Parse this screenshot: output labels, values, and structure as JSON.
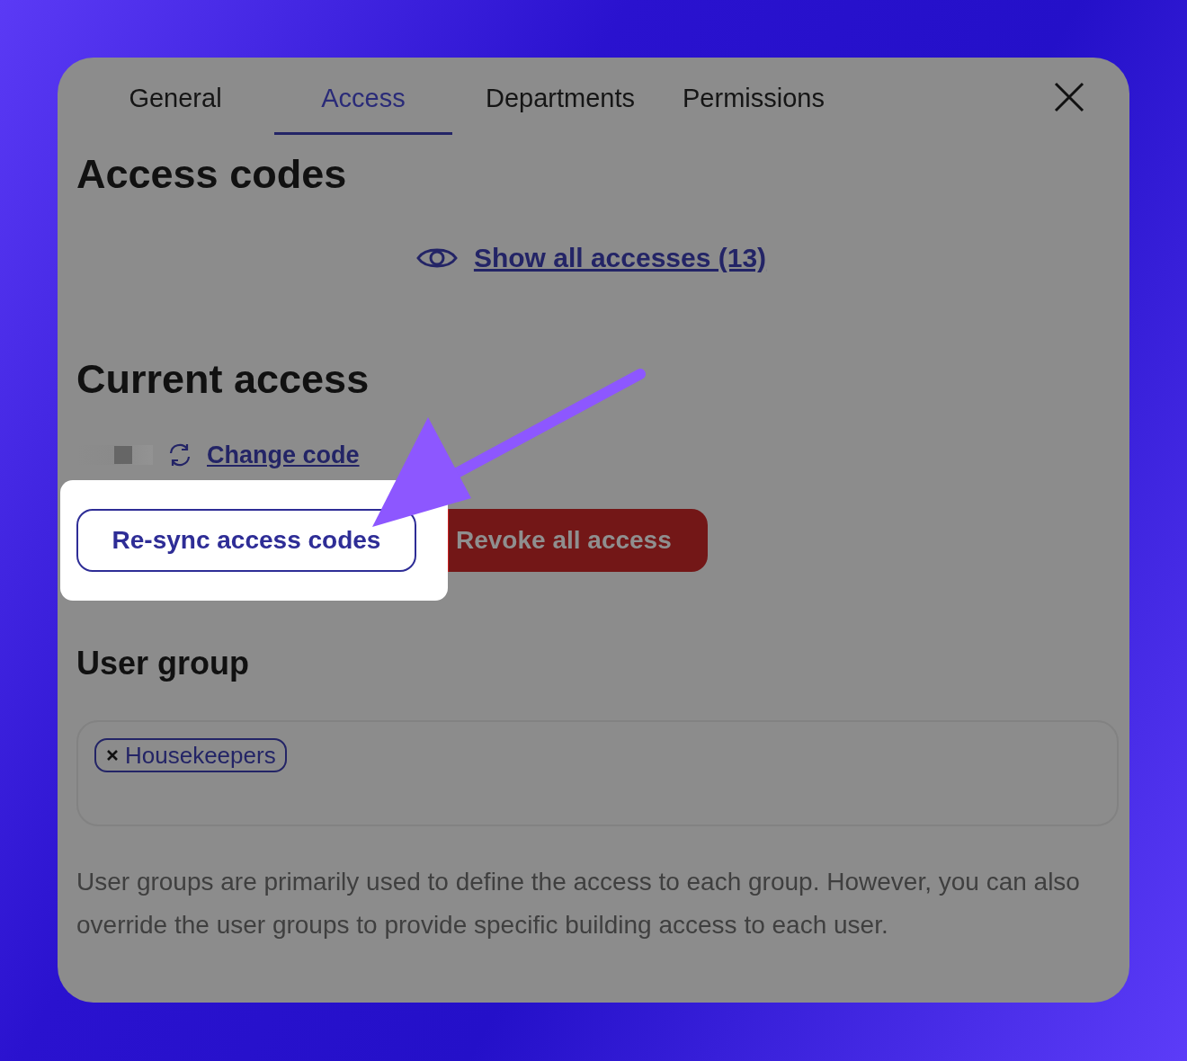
{
  "tabs": [
    {
      "label": "General",
      "selected": false
    },
    {
      "label": "Access",
      "selected": true
    },
    {
      "label": "Departments",
      "selected": false
    },
    {
      "label": "Permissions",
      "selected": false
    }
  ],
  "access_codes": {
    "title": "Access codes",
    "show_all_link": "Show all accesses (13)"
  },
  "current_access": {
    "title": "Current access",
    "change_code_link": "Change code",
    "buttons": [
      {
        "label": "Re-sync access codes",
        "kind": "outline",
        "highlighted": true
      },
      {
        "label": "Revoke all access",
        "kind": "danger",
        "highlighted": false
      }
    ]
  },
  "user_group": {
    "title": "User group",
    "tags": [
      {
        "label": "Housekeepers"
      }
    ],
    "help_text": "User groups are primarily used to define the access to each group. However, you can also override the user groups to provide specific building access to each user."
  }
}
